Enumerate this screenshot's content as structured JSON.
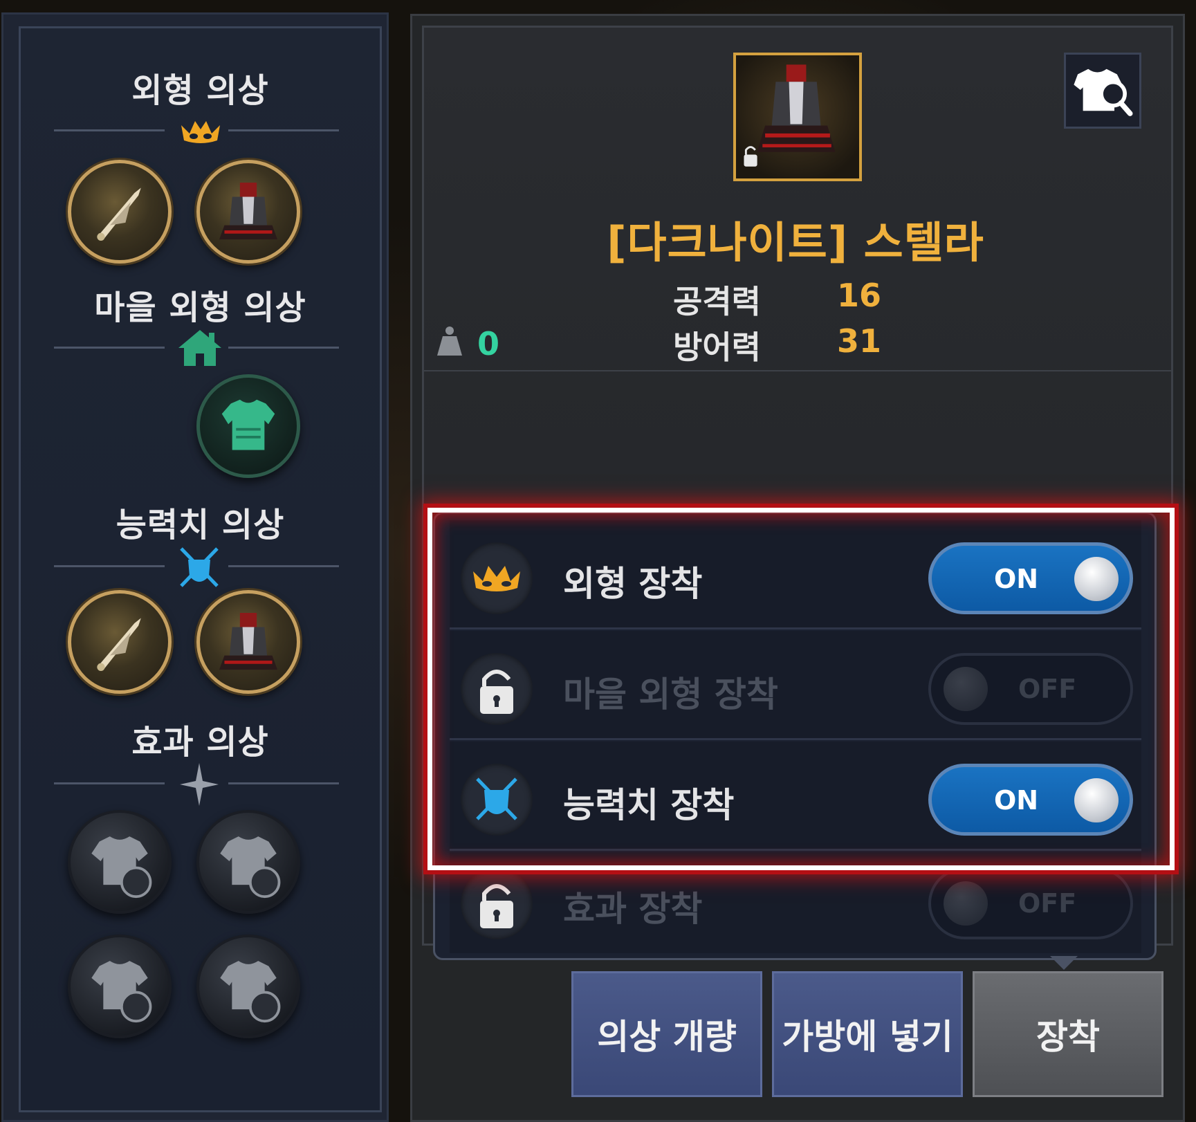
{
  "left_panel": {
    "sections": [
      {
        "title": "외형 의상",
        "icon": "mask-icon"
      },
      {
        "title": "마을 외형 의상",
        "icon": "house-icon"
      },
      {
        "title": "능력치 의상",
        "icon": "crossed-swords-shield-icon"
      },
      {
        "title": "효과 의상",
        "icon": "sparkle-icon"
      }
    ]
  },
  "item": {
    "name": "[다크나이트] 스텔라",
    "stats": [
      {
        "label": "공격력",
        "value": "16"
      },
      {
        "label": "방어력",
        "value": "31"
      }
    ],
    "weight": "0"
  },
  "options": [
    {
      "label": "외형 장착",
      "state": "ON",
      "icon": "mask-icon",
      "enabled": true
    },
    {
      "label": "마을 외형 장착",
      "state": "OFF",
      "icon": "lock-icon",
      "enabled": false
    },
    {
      "label": "능력치 장착",
      "state": "ON",
      "icon": "crossed-swords-shield-icon",
      "enabled": true
    },
    {
      "label": "효과 장착",
      "state": "OFF",
      "icon": "lock-icon",
      "enabled": false
    }
  ],
  "buttons": {
    "improve": "의상 개량",
    "to_bag": "가방에 넣기",
    "equip": "장착"
  },
  "colors": {
    "accent_gold": "#f0b13d",
    "toggle_on": "#1a73c2",
    "highlight": "#b40f14"
  }
}
